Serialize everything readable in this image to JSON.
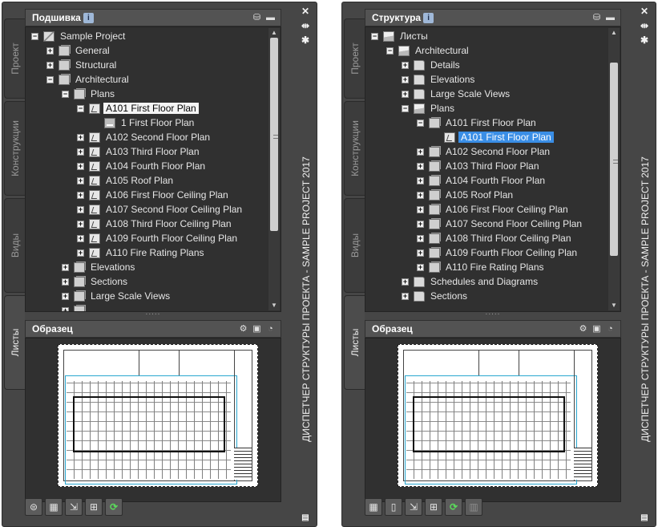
{
  "left": {
    "tabs": [
      "Проект",
      "Конструкции",
      "Виды",
      "Листы"
    ],
    "header": {
      "title": "Подшивка",
      "info_badge": "i"
    },
    "tree": [
      {
        "level": 0,
        "expander": "-",
        "icon": "sheetset",
        "label": "Sample Project",
        "state": ""
      },
      {
        "level": 1,
        "expander": "+",
        "icon": "subset",
        "label": "General",
        "state": ""
      },
      {
        "level": 1,
        "expander": "+",
        "icon": "subset",
        "label": "Structural",
        "state": ""
      },
      {
        "level": 1,
        "expander": "-",
        "icon": "subset",
        "label": "Architectural",
        "state": ""
      },
      {
        "level": 2,
        "expander": "-",
        "icon": "subset",
        "label": "Plans",
        "state": ""
      },
      {
        "level": 3,
        "expander": "-",
        "icon": "sheet",
        "label": "A101 First Floor Plan",
        "state": "selected"
      },
      {
        "level": 4,
        "expander": "",
        "icon": "view",
        "label": "1 First Floor Plan",
        "state": ""
      },
      {
        "level": 3,
        "expander": "+",
        "icon": "sheet",
        "label": "A102 Second Floor Plan",
        "state": ""
      },
      {
        "level": 3,
        "expander": "+",
        "icon": "sheet",
        "label": "A103 Third Floor Plan",
        "state": ""
      },
      {
        "level": 3,
        "expander": "+",
        "icon": "sheet",
        "label": "A104 Fourth Floor Plan",
        "state": ""
      },
      {
        "level": 3,
        "expander": "+",
        "icon": "sheet",
        "label": "A105 Roof Plan",
        "state": ""
      },
      {
        "level": 3,
        "expander": "+",
        "icon": "sheet",
        "label": "A106 First Floor Ceiling Plan",
        "state": ""
      },
      {
        "level": 3,
        "expander": "+",
        "icon": "sheet",
        "label": "A107 Second Floor Ceiling Plan",
        "state": ""
      },
      {
        "level": 3,
        "expander": "+",
        "icon": "sheet",
        "label": "A108 Third Floor Ceiling Plan",
        "state": ""
      },
      {
        "level": 3,
        "expander": "+",
        "icon": "sheet",
        "label": "A109 Fourth Floor Ceiling Plan",
        "state": ""
      },
      {
        "level": 3,
        "expander": "+",
        "icon": "sheet",
        "label": "A110 Fire Rating Plans",
        "state": ""
      },
      {
        "level": 2,
        "expander": "+",
        "icon": "subset",
        "label": "Elevations",
        "state": ""
      },
      {
        "level": 2,
        "expander": "+",
        "icon": "subset",
        "label": "Sections",
        "state": ""
      },
      {
        "level": 2,
        "expander": "+",
        "icon": "subset",
        "label": "Large Scale Views",
        "state": ""
      },
      {
        "level": 2,
        "expander": "+",
        "icon": "subset",
        "label": "",
        "state": ""
      }
    ],
    "scroll": {
      "thumb_fraction": 0.73,
      "position_fraction": 0.0
    },
    "preview": {
      "title": "Образец"
    },
    "toolbar": [
      "publish-icon",
      "new-sheet-icon",
      "view-select-icon",
      "resource-drawings-icon",
      "refresh-icon"
    ],
    "panel_title": "ДИСПЕТЧЕР СТРУКТУРЫ ПРОЕКТА - SAMPLE PROJECT 2017"
  },
  "right": {
    "tabs": [
      "Проект",
      "Конструкции",
      "Виды",
      "Листы"
    ],
    "header": {
      "title": "Структура",
      "info_badge": "i"
    },
    "tree": [
      {
        "level": 0,
        "expander": "-",
        "icon": "folder-open",
        "label": "Листы",
        "state": ""
      },
      {
        "level": 1,
        "expander": "-",
        "icon": "folder-open",
        "label": "Architectural",
        "state": ""
      },
      {
        "level": 2,
        "expander": "+",
        "icon": "folder",
        "label": "Details",
        "state": ""
      },
      {
        "level": 2,
        "expander": "+",
        "icon": "folder",
        "label": "Elevations",
        "state": ""
      },
      {
        "level": 2,
        "expander": "+",
        "icon": "folder",
        "label": "Large Scale Views",
        "state": ""
      },
      {
        "level": 2,
        "expander": "-",
        "icon": "folder-open",
        "label": "Plans",
        "state": ""
      },
      {
        "level": 3,
        "expander": "-",
        "icon": "subset",
        "label": "A101 First Floor Plan",
        "state": ""
      },
      {
        "level": 4,
        "expander": "",
        "icon": "sheet",
        "label": "A101 First Floor Plan",
        "state": "selected-blue"
      },
      {
        "level": 3,
        "expander": "+",
        "icon": "subset",
        "label": "A102 Second Floor Plan",
        "state": ""
      },
      {
        "level": 3,
        "expander": "+",
        "icon": "subset",
        "label": "A103 Third Floor Plan",
        "state": ""
      },
      {
        "level": 3,
        "expander": "+",
        "icon": "subset",
        "label": "A104 Fourth Floor Plan",
        "state": ""
      },
      {
        "level": 3,
        "expander": "+",
        "icon": "subset",
        "label": "A105 Roof Plan",
        "state": ""
      },
      {
        "level": 3,
        "expander": "+",
        "icon": "subset",
        "label": "A106 First Floor Ceiling Plan",
        "state": ""
      },
      {
        "level": 3,
        "expander": "+",
        "icon": "subset",
        "label": "A107 Second Floor Ceiling Plan",
        "state": ""
      },
      {
        "level": 3,
        "expander": "+",
        "icon": "subset",
        "label": "A108 Third Floor Ceiling Plan",
        "state": ""
      },
      {
        "level": 3,
        "expander": "+",
        "icon": "subset",
        "label": "A109 Fourth Floor Ceiling Plan",
        "state": ""
      },
      {
        "level": 3,
        "expander": "+",
        "icon": "subset",
        "label": "A110 Fire Rating Plans",
        "state": ""
      },
      {
        "level": 2,
        "expander": "+",
        "icon": "folder",
        "label": "Schedules and Diagrams",
        "state": ""
      },
      {
        "level": 2,
        "expander": "+",
        "icon": "folder",
        "label": "Sections",
        "state": ""
      }
    ],
    "scroll": {
      "thumb_fraction": 0.73,
      "position_fraction": 0.35
    },
    "preview": {
      "title": "Образец"
    },
    "toolbar": [
      "new-sheet-icon",
      "new-document-icon",
      "view-select-icon",
      "resource-drawings-icon",
      "refresh-icon",
      "disabled-sheet-icon"
    ],
    "panel_title": "ДИСПЕТЧЕР СТРУКТУРЫ ПРОЕКТА - SAMPLE PROJECT 2017"
  },
  "colors": {
    "panel_bg": "#464646",
    "tree_bg": "#303030",
    "selection_blue": "#3a8ee6",
    "selection_white": "#f4f4f4",
    "viewport_frame": "#2aa7d0"
  }
}
